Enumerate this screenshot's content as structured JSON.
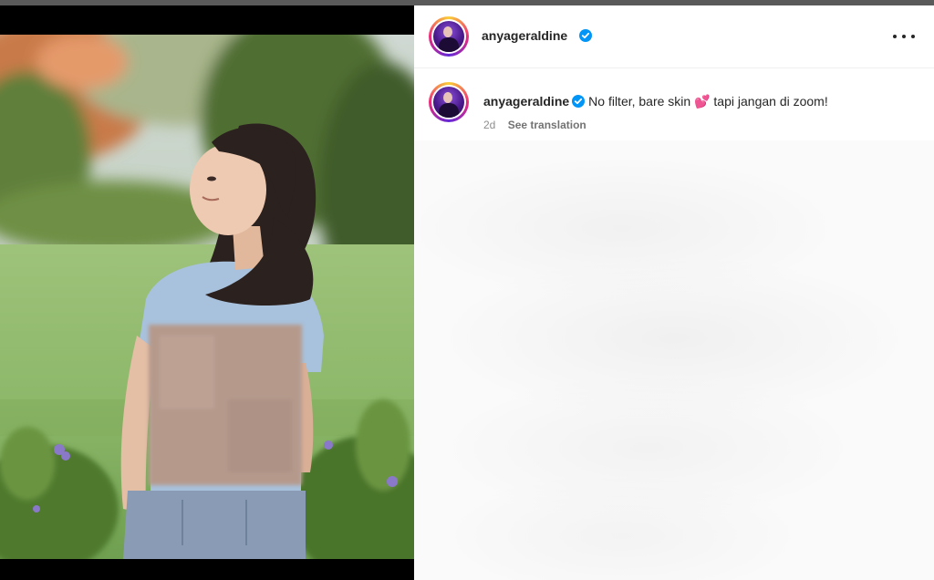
{
  "post": {
    "header": {
      "username": "anyageraldine",
      "verified_icon": "verified-badge-icon",
      "more_icon": "more-options-icon"
    },
    "caption": {
      "username": "anyageraldine",
      "text_before_emoji": "No filter, bare skin ",
      "emoji": "💕",
      "text_after_emoji": " tapi jangan di zoom!",
      "timestamp": "2d",
      "see_translation": "See translation"
    },
    "media": {
      "description_icon": "post-photo",
      "censored_region": true
    },
    "colors": {
      "verified": "#0095f6",
      "text": "#262626",
      "muted": "#8e8e8e"
    }
  }
}
